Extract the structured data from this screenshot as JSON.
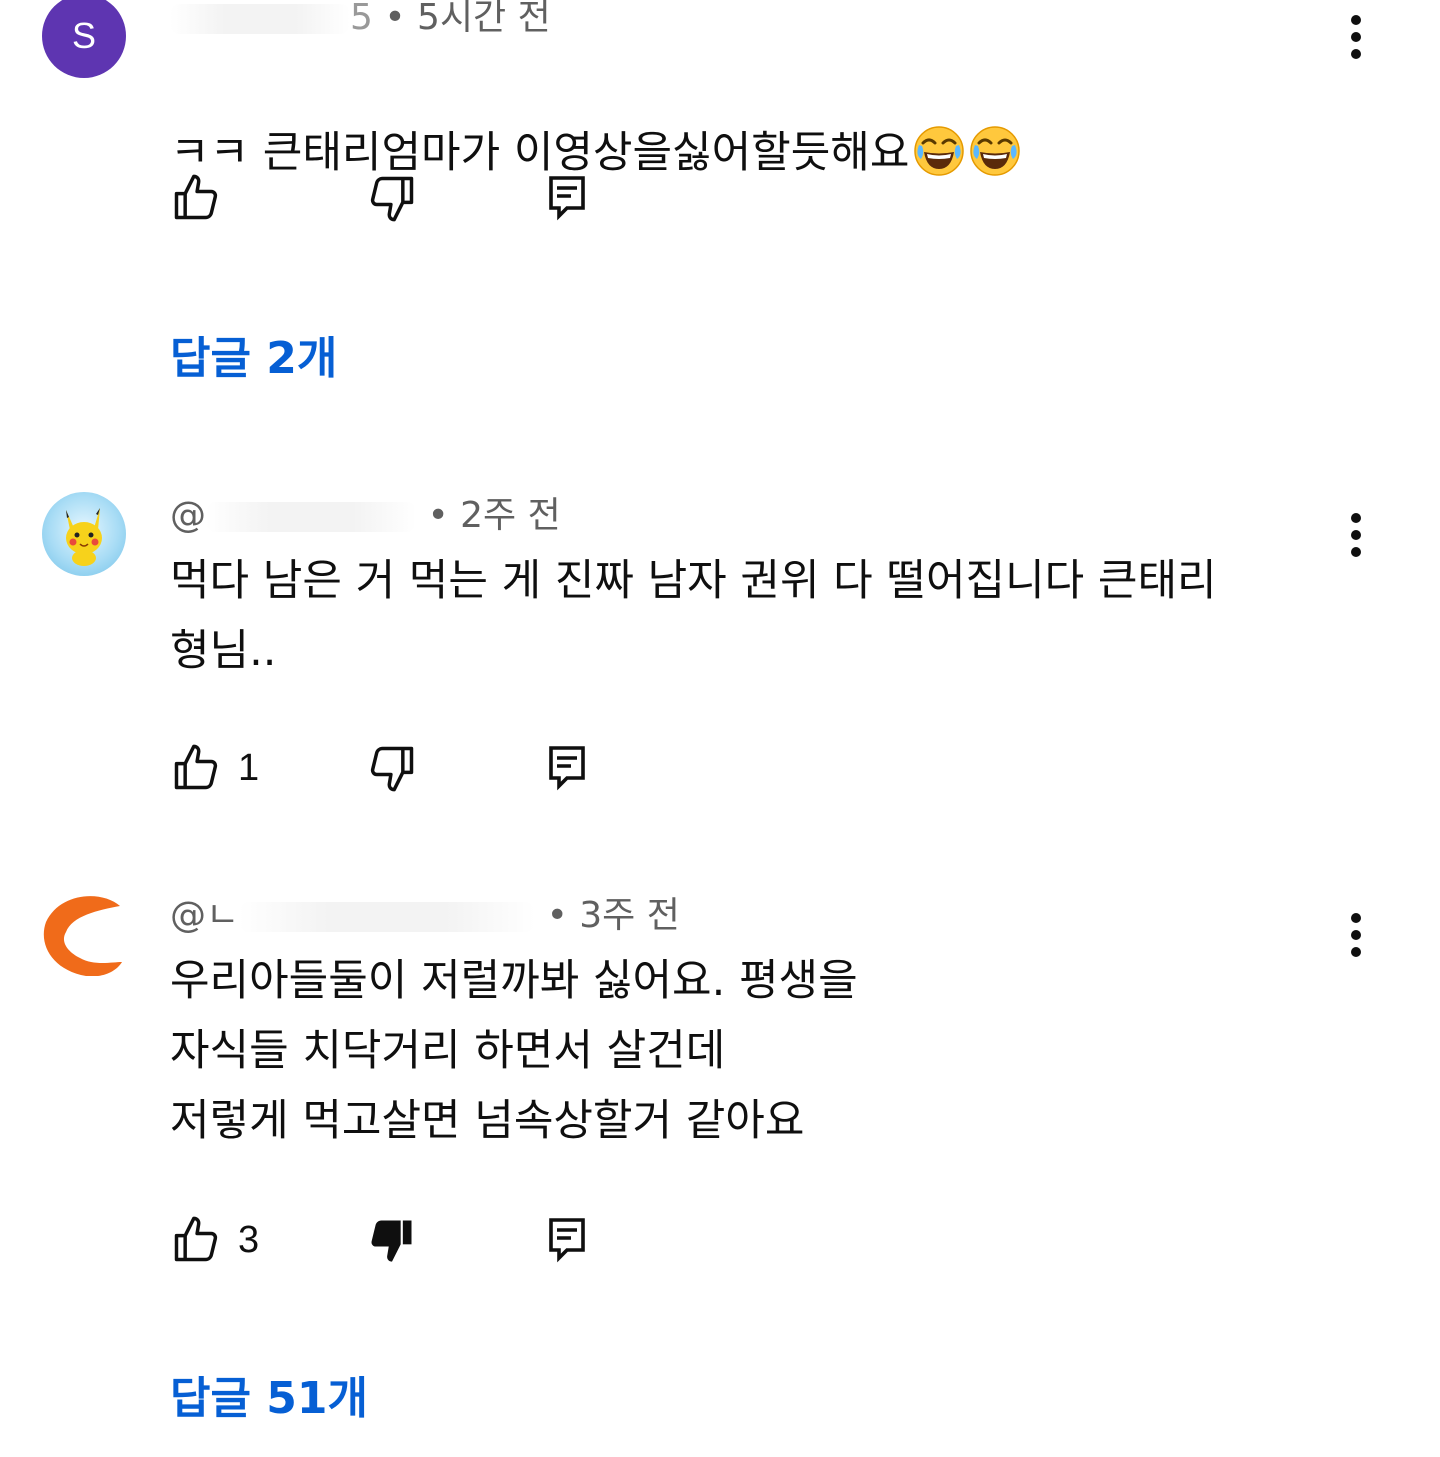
{
  "colors": {
    "accent": "#065fd4",
    "meta_text": "#606060",
    "text": "#0f0f0f",
    "avatar_purple": "#5e35b1",
    "avatar_orange": "#f06b1a"
  },
  "comments": [
    {
      "avatar_letter": "S",
      "handle_visible": "5",
      "time": "• 5시간 전",
      "text": "ㅋㅋ 큰태리엄마가 이영상을싫어할듯해요",
      "emojis": [
        "face-with-tears-of-joy",
        "face-with-tears-of-joy"
      ],
      "like_count": "",
      "disliked": false,
      "replies_label": "답글 2개"
    },
    {
      "avatar_icon": "pikachu-avatar",
      "handle_visible": "@",
      "time": "• 2주 전",
      "text": "먹다 남은 거 먹는 게 진짜 남자 권위 다 떨어집니다 큰태리\n형님..",
      "like_count": "1",
      "disliked": false
    },
    {
      "avatar_icon": "orange-swoosh-avatar",
      "handle_visible": "@ㄴ",
      "time": "• 3주 전",
      "text": "우리아들둘이 저럴까봐 싫어요. 평생을\n자식들 치닥거리 하면서 살건데\n저렇게 먹고살면 넘속상할거 같아요",
      "like_count": "3",
      "disliked": true,
      "replies_label": "답글 51개"
    }
  ]
}
